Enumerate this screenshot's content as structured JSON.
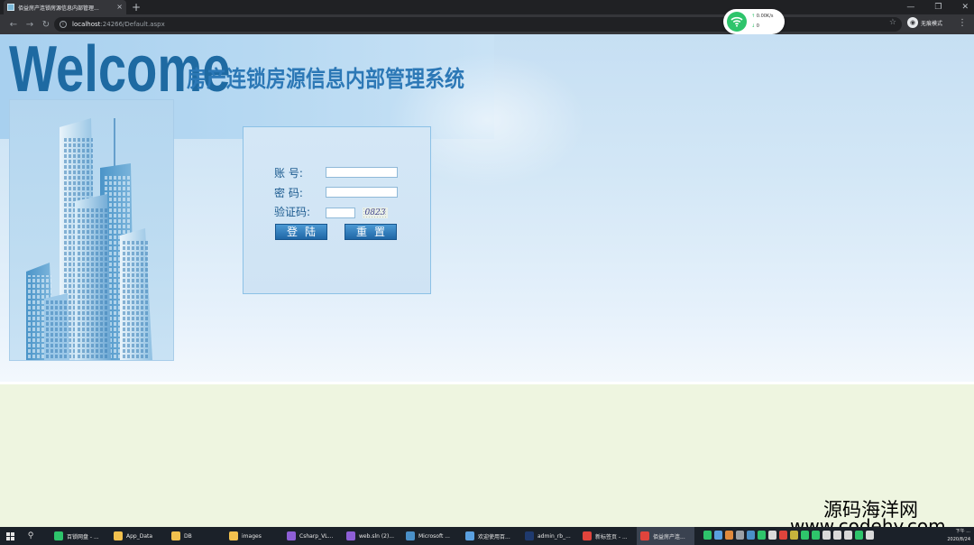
{
  "browser": {
    "tab_title": "佰益房产连锁房源信息内部管理...",
    "tab_close": "×",
    "new_tab": "+",
    "url_host": "localhost",
    "url_rest": ":24266/Default.aspx",
    "profile_label": "无痕模式",
    "window_controls": [
      "—",
      "❐",
      "✕"
    ]
  },
  "speed_widget": {
    "upload": "0.00K/s",
    "download": "0"
  },
  "page": {
    "welcome": "Welcome",
    "system_title": "房产连锁房源信息内部管理系统",
    "login": {
      "account_label": "账  号:",
      "password_label": "密  码:",
      "captcha_label": "验证码:",
      "account_value": "",
      "password_value": "",
      "captcha_value": "",
      "captcha_image_text": "0823",
      "login_button": "登陆",
      "reset_button": "重置"
    }
  },
  "watermark": {
    "cn": "源码海洋网",
    "url": "www.codehy.com"
  },
  "taskbar": {
    "items": [
      {
        "label": "百锁网盘 - ...",
        "color": "#2ec46b"
      },
      {
        "label": "App_Data",
        "color": "#f2c14e"
      },
      {
        "label": "DB",
        "color": "#f2c14e"
      },
      {
        "label": "images",
        "color": "#f2c14e"
      },
      {
        "label": "Csharp_VL...",
        "color": "#8e5fd6"
      },
      {
        "label": "web.sln (2)...",
        "color": "#8e5fd6"
      },
      {
        "label": "Microsoft ...",
        "color": "#4a90c8"
      },
      {
        "label": "欢迎使用百...",
        "color": "#5aa0e0"
      },
      {
        "label": "admin_rb_...",
        "color": "#1f3a6e"
      },
      {
        "label": "新标签页 - ...",
        "color": "#e0443c"
      },
      {
        "label": "佰益房产连...",
        "color": "#e0443c"
      }
    ],
    "active_index": 10,
    "clock_time": "下午 ...",
    "clock_date": "2020/8/24"
  }
}
